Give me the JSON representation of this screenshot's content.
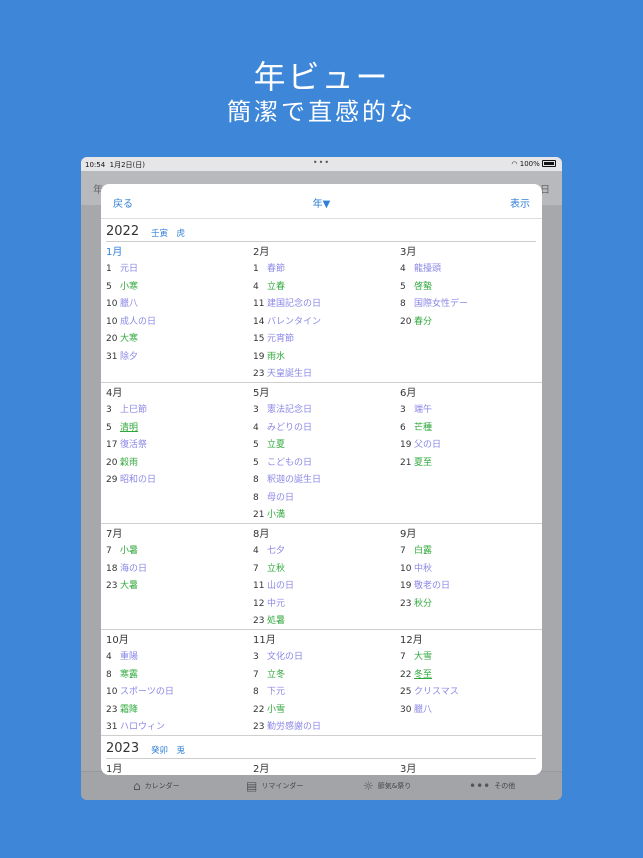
{
  "headline": {
    "title": "年ビュー",
    "subtitle": "簡潔で直感的な"
  },
  "status": {
    "time": "10:54",
    "date": "1月2日(日)",
    "battery": "100%"
  },
  "bg_nav": {
    "left": "年",
    "right": "日"
  },
  "sheet": {
    "back": "戻る",
    "title": "年▼",
    "show": "表示"
  },
  "years": [
    {
      "year": "2022",
      "eto": "壬寅　虎"
    },
    {
      "year": "2023",
      "eto": "癸卯　兎"
    }
  ],
  "months": [
    {
      "label": "1月",
      "current": true,
      "events": [
        {
          "d": "1",
          "n": "元日",
          "t": "p"
        },
        {
          "d": "5",
          "n": "小寒",
          "t": "g"
        },
        {
          "d": "10",
          "n": "臘八",
          "t": "p"
        },
        {
          "d": "10",
          "n": "成人の日",
          "t": "p"
        },
        {
          "d": "20",
          "n": "大寒",
          "t": "g"
        },
        {
          "d": "31",
          "n": "除夕",
          "t": "p"
        }
      ]
    },
    {
      "label": "2月",
      "events": [
        {
          "d": "1",
          "n": "春節",
          "t": "p"
        },
        {
          "d": "4",
          "n": "立春",
          "t": "g"
        },
        {
          "d": "11",
          "n": "建国記念の日",
          "t": "p"
        },
        {
          "d": "14",
          "n": "バレンタイン",
          "t": "p"
        },
        {
          "d": "15",
          "n": "元宵節",
          "t": "p"
        },
        {
          "d": "19",
          "n": "雨水",
          "t": "g"
        },
        {
          "d": "23",
          "n": "天皇誕生日",
          "t": "p"
        }
      ]
    },
    {
      "label": "3月",
      "events": [
        {
          "d": "4",
          "n": "龍擡頭",
          "t": "p"
        },
        {
          "d": "5",
          "n": "啓蟄",
          "t": "g"
        },
        {
          "d": "8",
          "n": "国際女性デー",
          "t": "p"
        },
        {
          "d": "20",
          "n": "春分",
          "t": "g"
        }
      ]
    },
    {
      "label": "4月",
      "events": [
        {
          "d": "3",
          "n": "上巳節",
          "t": "p"
        },
        {
          "d": "5",
          "n": "清明",
          "t": "g",
          "u": true
        },
        {
          "d": "17",
          "n": "復活祭",
          "t": "p"
        },
        {
          "d": "20",
          "n": "穀雨",
          "t": "g"
        },
        {
          "d": "29",
          "n": "昭和の日",
          "t": "p"
        }
      ]
    },
    {
      "label": "5月",
      "events": [
        {
          "d": "3",
          "n": "憲法記念日",
          "t": "p"
        },
        {
          "d": "4",
          "n": "みどりの日",
          "t": "p"
        },
        {
          "d": "5",
          "n": "立夏",
          "t": "g"
        },
        {
          "d": "5",
          "n": "こどもの日",
          "t": "p"
        },
        {
          "d": "8",
          "n": "釈迦の誕生日",
          "t": "p"
        },
        {
          "d": "8",
          "n": "母の日",
          "t": "p"
        },
        {
          "d": "21",
          "n": "小満",
          "t": "g"
        }
      ]
    },
    {
      "label": "6月",
      "events": [
        {
          "d": "3",
          "n": "端午",
          "t": "p"
        },
        {
          "d": "6",
          "n": "芒種",
          "t": "g"
        },
        {
          "d": "19",
          "n": "父の日",
          "t": "p"
        },
        {
          "d": "21",
          "n": "夏至",
          "t": "g"
        }
      ]
    },
    {
      "label": "7月",
      "events": [
        {
          "d": "7",
          "n": "小暑",
          "t": "g"
        },
        {
          "d": "18",
          "n": "海の日",
          "t": "p"
        },
        {
          "d": "23",
          "n": "大暑",
          "t": "g"
        }
      ]
    },
    {
      "label": "8月",
      "events": [
        {
          "d": "4",
          "n": "七夕",
          "t": "p"
        },
        {
          "d": "7",
          "n": "立秋",
          "t": "g"
        },
        {
          "d": "11",
          "n": "山の日",
          "t": "p"
        },
        {
          "d": "12",
          "n": "中元",
          "t": "p"
        },
        {
          "d": "23",
          "n": "処暑",
          "t": "g"
        }
      ]
    },
    {
      "label": "9月",
      "events": [
        {
          "d": "7",
          "n": "白露",
          "t": "g"
        },
        {
          "d": "10",
          "n": "中秋",
          "t": "p"
        },
        {
          "d": "19",
          "n": "敬老の日",
          "t": "p"
        },
        {
          "d": "23",
          "n": "秋分",
          "t": "g"
        }
      ]
    },
    {
      "label": "10月",
      "events": [
        {
          "d": "4",
          "n": "重陽",
          "t": "p"
        },
        {
          "d": "8",
          "n": "寒露",
          "t": "g"
        },
        {
          "d": "10",
          "n": "スポーツの日",
          "t": "p"
        },
        {
          "d": "23",
          "n": "霜降",
          "t": "g"
        },
        {
          "d": "31",
          "n": "ハロウィン",
          "t": "p"
        }
      ]
    },
    {
      "label": "11月",
      "events": [
        {
          "d": "3",
          "n": "文化の日",
          "t": "p"
        },
        {
          "d": "7",
          "n": "立冬",
          "t": "g"
        },
        {
          "d": "8",
          "n": "下元",
          "t": "p"
        },
        {
          "d": "22",
          "n": "小雪",
          "t": "g"
        },
        {
          "d": "23",
          "n": "勤労感謝の日",
          "t": "p"
        }
      ]
    },
    {
      "label": "12月",
      "events": [
        {
          "d": "7",
          "n": "大雪",
          "t": "g"
        },
        {
          "d": "22",
          "n": "冬至",
          "t": "g",
          "u": true
        },
        {
          "d": "25",
          "n": "クリスマス",
          "t": "p"
        },
        {
          "d": "30",
          "n": "臘八",
          "t": "p"
        }
      ]
    }
  ],
  "next_months": [
    "1月",
    "2月",
    "3月"
  ],
  "tabs": [
    {
      "label": "カレンダー",
      "icon": "home-icon"
    },
    {
      "label": "リマインダー",
      "icon": "list-icon"
    },
    {
      "label": "節気&祭り",
      "icon": "sun-icon"
    },
    {
      "label": "その他",
      "icon": "more-icon"
    }
  ]
}
